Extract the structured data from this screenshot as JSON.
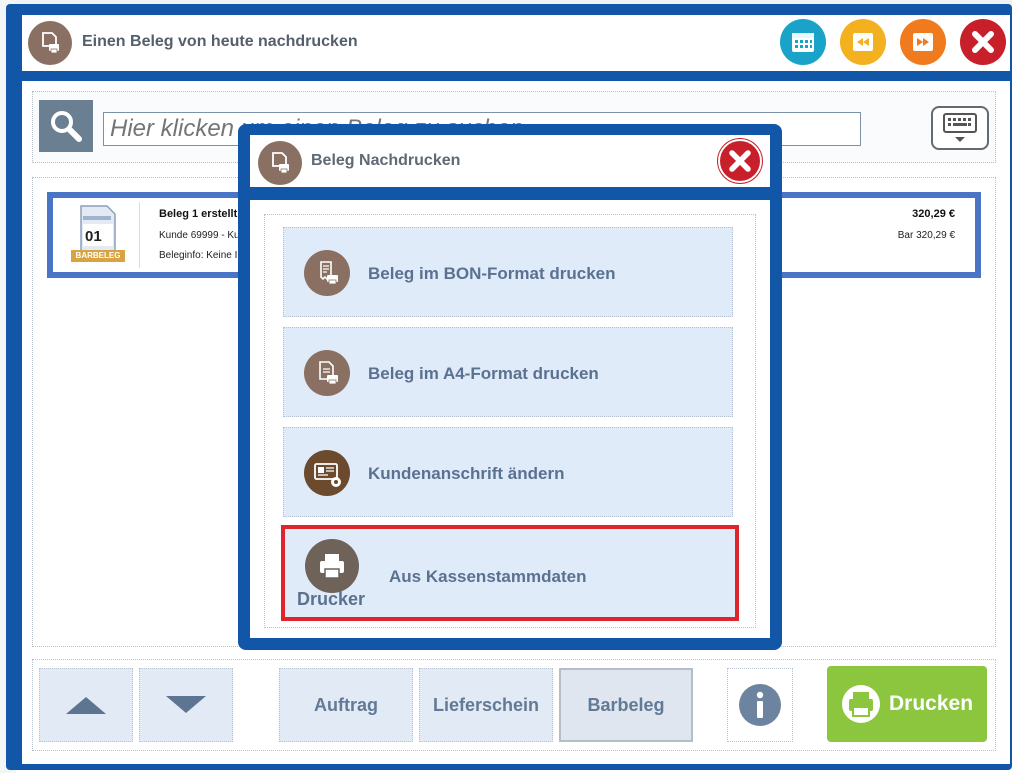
{
  "window": {
    "title": "Einen Beleg von heute nachdrucken",
    "buttons": [
      "calendar-icon",
      "rewind-icon",
      "fast-forward-icon",
      "close-icon"
    ],
    "colors": {
      "frame": "#1256a8",
      "calendar": "#1aa3c8",
      "rewind": "#f3b120",
      "forward": "#f07a1e",
      "close": "#c8202a"
    }
  },
  "search": {
    "placeholder": "Hier klicken um einen Beleg zu suchen"
  },
  "receipt": {
    "badge": "BARBELEG",
    "doc_number": "01",
    "title": "Beleg 1 erstellt",
    "customer_line": "Kunde 69999 - Ku",
    "info_line": "Beleginfo: Keine I",
    "amount": "320,29 €",
    "payment": "Bar 320,29 €"
  },
  "bottom": {
    "doc_types": [
      "Auftrag",
      "Lieferschein",
      "Barbeleg"
    ],
    "active_doc_type": "Barbeleg",
    "print_label": "Drucken",
    "print_color": "#8cc63f"
  },
  "modal": {
    "title": "Beleg Nachdrucken",
    "options": [
      {
        "label": "Beleg im BON-Format drucken",
        "icon": "receipt-printer-icon"
      },
      {
        "label": "Beleg im A4-Format drucken",
        "icon": "document-printer-icon"
      },
      {
        "label": "Kundenanschrift ändern",
        "icon": "address-card-icon"
      },
      {
        "label": "Aus Kassenstammdaten",
        "sublabel": "Drucker",
        "icon": "printer-icon",
        "selected": true
      }
    ],
    "highlight_color": "#e0242c"
  }
}
